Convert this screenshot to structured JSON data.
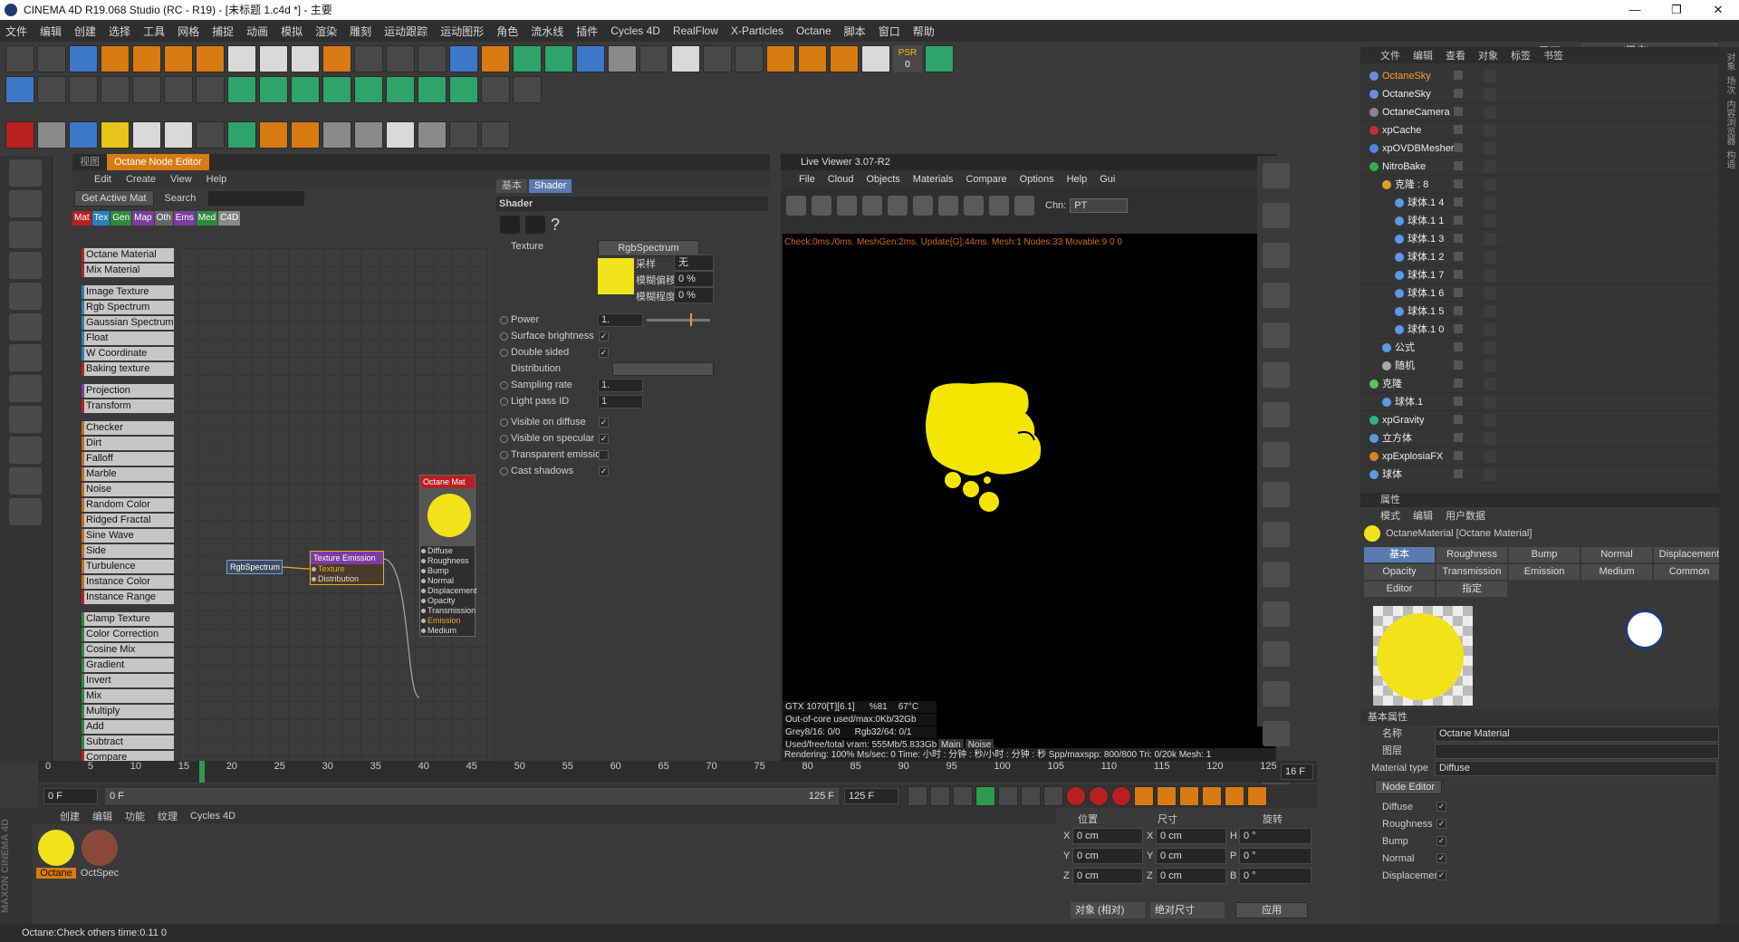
{
  "window": {
    "title": "CINEMA 4D R19.068 Studio (RC - R19) - [未标题 1.c4d *] - 主要",
    "controls": [
      "—",
      "❐",
      "✕"
    ]
  },
  "menubar": [
    "文件",
    "编辑",
    "创建",
    "选择",
    "工具",
    "网格",
    "捕捉",
    "动画",
    "模拟",
    "渲染",
    "雕刻",
    "运动跟踪",
    "运动图形",
    "角色",
    "流水线",
    "插件",
    "Cycles 4D",
    "RealFlow",
    "X-Particles",
    "Octane",
    "脚本",
    "窗口",
    "帮助"
  ],
  "interface": {
    "label": "界面:",
    "value": "octane (用户)"
  },
  "toolbar": {
    "psr_label": "PSR",
    "psr_value": "0"
  },
  "node_editor": {
    "tabs": [
      "视图",
      "Octane Node Editor"
    ],
    "menu": [
      "Edit",
      "Create",
      "View",
      "Help"
    ],
    "get_active_mat": "Get Active Mat",
    "search_label": "Search",
    "categories": [
      {
        "label": "Mat",
        "color": "#b82020"
      },
      {
        "label": "Tex",
        "color": "#2a7fbf"
      },
      {
        "label": "Gen",
        "color": "#2d8a3a"
      },
      {
        "label": "Map",
        "color": "#7a3da0"
      },
      {
        "label": "Oth",
        "color": "#666666"
      },
      {
        "label": "Ems",
        "color": "#7a3da0"
      },
      {
        "label": "Med",
        "color": "#2d8a3a"
      },
      {
        "label": "C4D",
        "color": "#888888"
      }
    ],
    "nodes": [
      "Octane Material",
      "Mix Material",
      "",
      "Image Texture",
      "Rgb Spectrum",
      "Gaussian Spectrum",
      "Float",
      "W Coordinate",
      "Baking texture",
      "",
      "Projection",
      "Transform",
      "",
      "Checker",
      "Dirt",
      "Falloff",
      "Marble",
      "Noise",
      "Random Color",
      "Ridged Fractal",
      "Sine Wave",
      "Side",
      "Turbulence",
      "Instance Color",
      "Instance Range",
      "",
      "Clamp Texture",
      "Color Correction",
      "Cosine Mix",
      "Gradient",
      "Invert",
      "Mix",
      "Multiply",
      "Add",
      "Subtract",
      "Compare"
    ],
    "graph": {
      "rgb": "RgbSpectrum",
      "emission": {
        "title": "Texture Emission",
        "pins": [
          "Texture",
          "Distribution"
        ]
      },
      "mat": {
        "title": "Octane Mat",
        "pins": [
          "Diffuse",
          "Roughness",
          "Bump",
          "Normal",
          "Displacement",
          "Opacity",
          "Transmission",
          "Emission",
          "Medium"
        ]
      }
    },
    "shader": {
      "tabs": [
        "基本",
        "Shader"
      ],
      "header": "Shader",
      "texture_label": "Texture",
      "texture_value": "RgbSpectrum",
      "sample_label": "采样",
      "sample_value": "无",
      "blur_offset_label": "模糊偏移",
      "blur_offset_value": "0 %",
      "blur_degree_label": "模糊程度",
      "blur_degree_value": "0 %",
      "power_label": "Power",
      "power_value": "1.",
      "surface_brightness": "Surface brightness",
      "double_sided": "Double sided",
      "distribution": "Distribution",
      "sampling_rate_label": "Sampling rate",
      "sampling_rate_value": "1.",
      "light_pass_label": "Light pass ID",
      "light_pass_value": "1",
      "visible_diffuse": "Visible on diffuse",
      "visible_specular": "Visible on specular",
      "transparent_emission": "Transparent emission",
      "cast_shadows": "Cast shadows",
      "check": "✓"
    }
  },
  "live_viewer": {
    "title": "Live Viewer 3.07-R2",
    "menu": [
      "File",
      "Cloud",
      "Objects",
      "Materials",
      "Compare",
      "Options",
      "Help",
      "Gui"
    ],
    "chn_label": "Chn:",
    "chn_value": "PT",
    "status": "Check:0ms./0ms. MeshGen:2ms. Update[G]:44ms. Mesh:1 Nodes:33 Movable:9  0 0",
    "gpu": {
      "name": "GTX 1070[T][6.1]",
      "usage": "%81",
      "temp": "67°C",
      "ooc": "Out-of-core used/max:0Kb/32Gb",
      "grey": "Grey8/16: 0/0",
      "rgb": "Rgb32/64: 0/1",
      "vram": "Used/free/total vram: 555Mb/5.833Gb/8Gb"
    },
    "tabs": [
      "Main",
      "Noise"
    ],
    "render_bar": "Rendering: 100%    Ms/sec: 0    Time: 小时 : 分钟 : 秒/小时 : 分钟 : 秒   Spp/maxspp: 800/800    Tri: 0/20k    Mesh: 1"
  },
  "object_manager": {
    "tabs": [
      "文件",
      "编辑",
      "查看",
      "对象",
      "标签",
      "书签"
    ],
    "objects": [
      {
        "name": "OctaneSky",
        "indent": 0,
        "color": "#ffa020",
        "icon": "#6a8fd8"
      },
      {
        "name": "OctaneSky",
        "indent": 0,
        "color": "#eeeeee",
        "icon": "#6a8fd8"
      },
      {
        "name": "OctaneCamera",
        "indent": 0,
        "color": "#eeeeee",
        "icon": "#888888"
      },
      {
        "name": "xpCache",
        "indent": 0,
        "color": "#eeeeee",
        "icon": "#c03030"
      },
      {
        "name": "xpOVDBMesher",
        "indent": 0,
        "color": "#eeeeee",
        "icon": "#4a8ad8"
      },
      {
        "name": "NitroBake",
        "indent": 0,
        "color": "#eeeeee",
        "icon": "#30b040"
      },
      {
        "name": "克隆 : 8",
        "indent": 1,
        "color": "#eeeeee",
        "icon": "#e0a020"
      },
      {
        "name": "球体.1 4",
        "indent": 2,
        "color": "#eeeeee",
        "icon": "#5a9ae8"
      },
      {
        "name": "球体.1 1",
        "indent": 2,
        "color": "#eeeeee",
        "icon": "#5a9ae8"
      },
      {
        "name": "球体.1 3",
        "indent": 2,
        "color": "#eeeeee",
        "icon": "#5a9ae8"
      },
      {
        "name": "球体.1 2",
        "indent": 2,
        "color": "#eeeeee",
        "icon": "#5a9ae8"
      },
      {
        "name": "球体.1 7",
        "indent": 2,
        "color": "#eeeeee",
        "icon": "#5a9ae8"
      },
      {
        "name": "球体.1 6",
        "indent": 2,
        "color": "#eeeeee",
        "icon": "#5a9ae8"
      },
      {
        "name": "球体.1 5",
        "indent": 2,
        "color": "#eeeeee",
        "icon": "#5a9ae8"
      },
      {
        "name": "球体.1 0",
        "indent": 2,
        "color": "#eeeeee",
        "icon": "#5a9ae8"
      },
      {
        "name": "公式",
        "indent": 1,
        "color": "#eeeeee",
        "icon": "#5a9ae8"
      },
      {
        "name": "随机",
        "indent": 1,
        "color": "#eeeeee",
        "icon": "#aaaaaa"
      },
      {
        "name": "克隆",
        "indent": 0,
        "color": "#eeeeee",
        "icon": "#60c060"
      },
      {
        "name": "球体.1",
        "indent": 1,
        "color": "#eeeeee",
        "icon": "#5a9ae8"
      },
      {
        "name": "xpGravity",
        "indent": 0,
        "color": "#eeeeee",
        "icon": "#30b080"
      },
      {
        "name": "立方体",
        "indent": 0,
        "color": "#eeeeee",
        "icon": "#5a9ae8"
      },
      {
        "name": "xpExplosiaFX",
        "indent": 0,
        "color": "#eeeeee",
        "icon": "#e08020"
      },
      {
        "name": "球体",
        "indent": 0,
        "color": "#eeeeee",
        "icon": "#5a9ae8"
      }
    ]
  },
  "attributes": {
    "panel_title": "属性",
    "menu": [
      "模式",
      "编辑",
      "用户数据"
    ],
    "material_name": "OctaneMaterial [Octane Material]",
    "tabs": [
      "基本",
      "Roughness",
      "Bump",
      "Normal",
      "Displacement",
      "Opacity",
      "Transmission",
      "Emission",
      "Medium",
      "Common",
      "Editor",
      "指定"
    ],
    "section": "基本属性",
    "name_label": "名称",
    "name_value": "Octane Material",
    "layer_label": "图层",
    "layer_value": "",
    "type_label": "Material type",
    "type_value": "Diffuse",
    "node_editor_btn": "Node Editor",
    "channels": [
      "Diffuse",
      "Roughness",
      "Bump",
      "Normal",
      "Displacement"
    ],
    "check": "✓"
  },
  "right_side_tabs": [
    "对象",
    "场次",
    "内容浏览器",
    "构造"
  ],
  "timeline": {
    "ticks": [
      "0",
      "5",
      "10",
      "15",
      "20",
      "25",
      "30",
      "35",
      "40",
      "45",
      "50",
      "55",
      "60",
      "65",
      "70",
      "75",
      "80",
      "85",
      "90",
      "95",
      "100",
      "105",
      "110",
      "115",
      "120",
      "125"
    ],
    "current": "16",
    "frame_field": "16 F"
  },
  "playback": {
    "start": "0 F",
    "range_start": "0 F",
    "range_end": "125 F",
    "end": "125 F"
  },
  "material_manager": {
    "menu": [
      "创建",
      "编辑",
      "功能",
      "纹理",
      "Cycles 4D"
    ],
    "materials": [
      {
        "name": "Octane",
        "color": "#f2e21a"
      },
      {
        "name": "OctSpec",
        "color": "#8a4a3a"
      }
    ]
  },
  "coordinates": {
    "headers": [
      "位置",
      "尺寸",
      "旋转"
    ],
    "rows": [
      {
        "axis": "X",
        "pos": "0 cm",
        "size": "0 cm",
        "rlabel": "H",
        "rot": "0 °"
      },
      {
        "axis": "Y",
        "pos": "0 cm",
        "size": "0 cm",
        "rlabel": "P",
        "rot": "0 °"
      },
      {
        "axis": "Z",
        "pos": "0 cm",
        "size": "0 cm",
        "rlabel": "B",
        "rot": "0 °"
      }
    ],
    "mode1": "对象 (相对)",
    "mode2": "绝对尺寸",
    "apply": "应用"
  },
  "status": "Octane:Check others time:0.11  0",
  "maxon": "MAXON CINEMA 4D",
  "colors": {
    "accent_orange": "#d87b12",
    "emission_yellow": "#f2e21a",
    "selected_blue": "#5a7bb0"
  }
}
